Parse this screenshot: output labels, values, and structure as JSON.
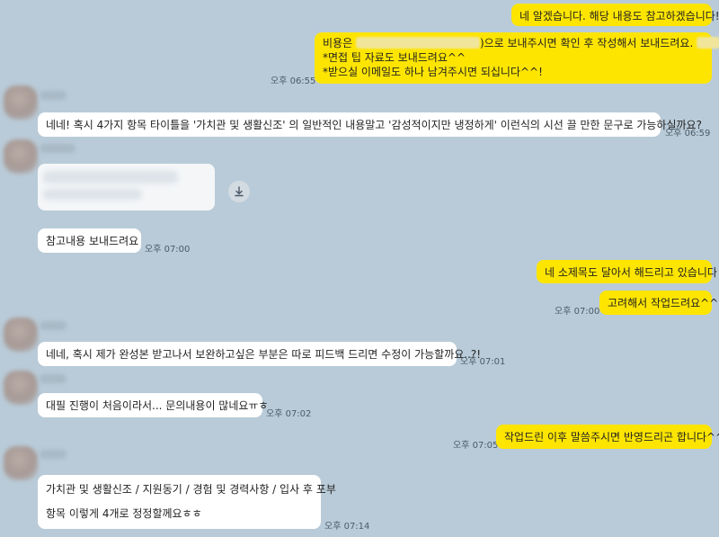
{
  "messages": {
    "m1": {
      "text": "네 알겠습니다. 해당 내용도 참고하겠습니다!"
    },
    "m2": {
      "line1_prefix": "비용은 ",
      "line1_suffix": ")으로 보내주시면 확인 후 작성해서 보내드려요. ",
      "line2": "*면접 팁 자료도 보내드려요^^",
      "line3": "*받으실 이메일도 하나 남겨주시면 되십니다^^!",
      "time": "오후 06:55"
    },
    "m3": {
      "text": "네네! 혹시 4가지 항목 타이틀을 '가치관 및 생활신조' 의 일반적인 내용말고 '감성적이지만 냉정하게' 이런식의 시선 끌 만한 문구로 가능하실까요?",
      "time": "오후 06:59"
    },
    "m5": {
      "text": "참고내용 보내드려요",
      "time": "오후 07:00"
    },
    "m6": {
      "text": "네 소제목도 달아서 해드리고 있습니다"
    },
    "m7": {
      "text": "고려해서 작업드려요^^",
      "time": "오후 07:00"
    },
    "m8": {
      "text": "네네, 혹시 제가 완성본 받고나서 보완하고싶은 부분은 따로 피드백 드리면 수정이 가능할까요..?!",
      "time": "오후 07:01"
    },
    "m9": {
      "text": "대필 진행이 처음이라서... 문의내용이 많네요ㅠㅎ",
      "time": "오후 07:02"
    },
    "m10": {
      "text": "작업드린 이후 말씀주시면 반영드리곤 합니다^^",
      "time": "오후 07:05"
    },
    "m11": {
      "line1": "가치관 및 생활신조 / 지원동기 / 경험 및 경력사항 / 입사 후 포부",
      "line2": "항목 이렇게 4개로 정정할께요ㅎㅎ",
      "time": "오후 07:14"
    }
  },
  "colors": {
    "background": "#b9cbd8",
    "my_bubble": "#fee500",
    "other_bubble": "#ffffff"
  },
  "icons": {
    "download": "download-icon",
    "avatar": "avatar-image"
  }
}
